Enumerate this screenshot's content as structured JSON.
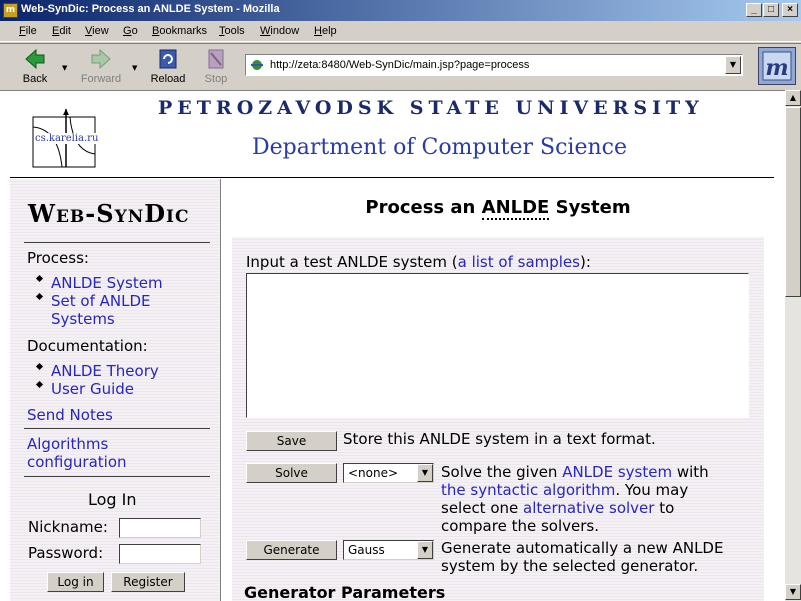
{
  "window": {
    "title": "Web-SynDic: Process an ANLDE System - Mozilla",
    "minimize": "_",
    "maximize": "□",
    "close": "×"
  },
  "menu": [
    {
      "label": "File",
      "u": "F",
      "rest": "ile"
    },
    {
      "label": "Edit",
      "u": "E",
      "rest": "dit"
    },
    {
      "label": "View",
      "u": "V",
      "rest": "iew"
    },
    {
      "label": "Go",
      "u": "G",
      "rest": "o"
    },
    {
      "label": "Bookmarks",
      "u": "B",
      "rest": "ookmarks"
    },
    {
      "label": "Tools",
      "u": "T",
      "rest": "ools"
    },
    {
      "label": "Window",
      "u": "W",
      "rest": "indow"
    },
    {
      "label": "Help",
      "u": "H",
      "rest": "elp"
    }
  ],
  "toolbar": {
    "back": "Back",
    "forward": "Forward",
    "reload": "Reload",
    "stop": "Stop"
  },
  "url": "http://zeta:8480/Web-SynDic/main.jsp?page=process",
  "header": {
    "logo_text": "cs.karelia.ru",
    "university": "PETROZAVODSK STATE UNIVERSITY",
    "department": "Department of Computer Science"
  },
  "sidebar": {
    "title": "Web-SynDic",
    "process_heading": "Process:",
    "process_links": [
      "ANLDE System",
      "Set of ANLDE",
      "Systems"
    ],
    "doc_heading": "Documentation:",
    "doc_links": [
      "ANLDE Theory",
      "User Guide"
    ],
    "send_notes": "Send Notes",
    "algorithms": [
      "Algorithms",
      "configuration"
    ],
    "login": {
      "title": "Log In",
      "nickname_label": "Nickname:",
      "password_label": "Password:",
      "login_button": "Log in",
      "register_button": "Register"
    }
  },
  "main": {
    "title_pre": "Process an ",
    "title_ul": "ANLDE",
    "title_post": " System",
    "input_label_pre": "Input a test ANLDE system (",
    "input_label_link": "a list of samples",
    "input_label_post": "):",
    "save_button": "Save",
    "save_desc": "Store this ANLDE system in a text format.",
    "solve_button": "Solve",
    "solve_select": "<none>",
    "solve_desc": {
      "l1_pre": "Solve the given ",
      "l1_link": "ANLDE system",
      "l1_post": " with",
      "l2_link": "the syntactic algorithm",
      "l2_post": ". You may",
      "l3_pre": "select one ",
      "l3_link": "alternative solver",
      "l3_post": " to",
      "l4": "compare the solvers."
    },
    "generate_button": "Generate",
    "generate_select": "Gauss",
    "generate_desc": {
      "l1": "Generate automatically a new ANLDE",
      "l2": "system by the selected generator."
    },
    "generator_params": "Generator Parameters"
  }
}
